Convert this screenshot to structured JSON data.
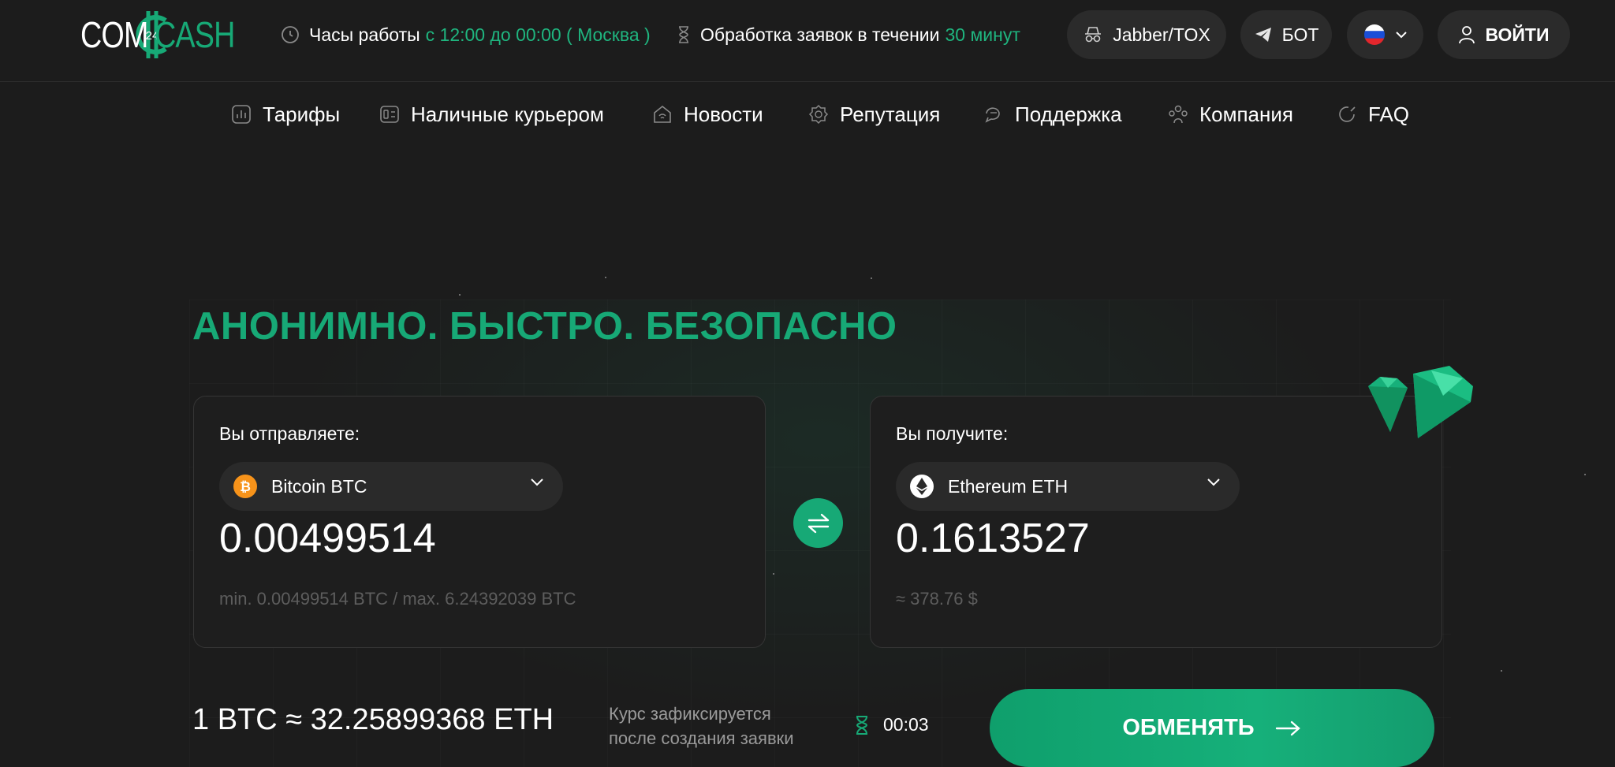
{
  "logo": {
    "left": "COM",
    "middle": "24",
    "right": "CASH"
  },
  "header": {
    "hours_label": "Часы работы",
    "hours_value": "с 12:00 до 00:00 ( Москва )",
    "processing_label": "Обработка заявок в течении",
    "processing_value": "30 минут",
    "jabber_label": "Jabber/TOX",
    "bot_label": "БОТ",
    "login_label": "ВОЙТИ"
  },
  "nav": {
    "items": [
      {
        "label": "Тарифы",
        "icon": "chart-icon"
      },
      {
        "label": "Наличные курьером",
        "icon": "wallet-icon"
      },
      {
        "label": "Новости",
        "icon": "news-icon"
      },
      {
        "label": "Репутация",
        "icon": "badge-icon"
      },
      {
        "label": "Поддержка",
        "icon": "chat-icon"
      },
      {
        "label": "Компания",
        "icon": "users-icon"
      },
      {
        "label": "FAQ",
        "icon": "faq-icon"
      }
    ]
  },
  "hero": {
    "title": "АНОНИМНО. БЫСТРО. БЕЗОПАСНО"
  },
  "send": {
    "label": "Вы отправляете:",
    "currency": "Bitcoin BTC",
    "amount": "0.00499514",
    "limits": "min. 0.00499514 BTC / max. 6.24392039 BTC"
  },
  "receive": {
    "label": "Вы получите:",
    "currency": "Ethereum ETH",
    "amount": "0.1613527",
    "usd": "≈ 378.76 $"
  },
  "rate": {
    "text": "1 BTC ≈ 32.25899368 ETH",
    "fix_note": "Курс зафиксируется после создания заявки",
    "timer": "00:03"
  },
  "exchange_button": "ОБМЕНЯТЬ",
  "colors": {
    "accent": "#17a976",
    "background": "#1c1c1c",
    "card": "#1e1e1e",
    "btc": "#f7931a"
  }
}
